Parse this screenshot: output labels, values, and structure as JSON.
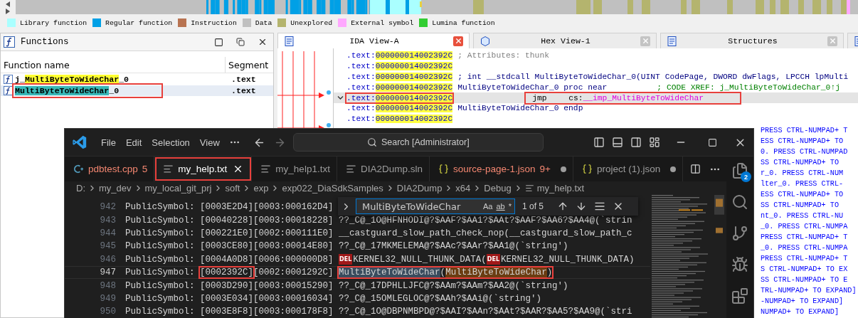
{
  "legend": [
    {
      "label": "Library function",
      "color": "#aaffff"
    },
    {
      "label": "Regular function",
      "color": "#00a0e6"
    },
    {
      "label": "Instruction",
      "color": "#b87351"
    },
    {
      "label": "Data",
      "color": "#c0c0c0"
    },
    {
      "label": "Unexplored",
      "color": "#b4b46e"
    },
    {
      "label": "External symbol",
      "color": "#ffa8ff"
    },
    {
      "label": "Lumina function",
      "color": "#32cd32"
    }
  ],
  "functions_panel": {
    "title": "Functions",
    "columns": [
      "Function name",
      "Segment"
    ],
    "rows": [
      {
        "prefix": "j_",
        "match": "MultiByteToWideChar",
        "suffix": "_0",
        "segment": ".text",
        "selected": false,
        "boxed": false
      },
      {
        "prefix": "",
        "match": "MultiByteToWideChar",
        "suffix": "_0",
        "segment": ".text",
        "selected": true,
        "boxed": true
      }
    ]
  },
  "ida_tabs": [
    {
      "label": "IDA View-A",
      "selected": true
    },
    {
      "label": "Hex View-1",
      "selected": false
    },
    {
      "label": "Structures",
      "selected": false
    },
    {
      "selected": false
    }
  ],
  "ida_listing": [
    {
      "segment": ".text:",
      "address": "000000014002392C",
      "kind": "attribute",
      "text": "; Attributes: thunk",
      "current": false,
      "boxed": false
    },
    {
      "segment": ".text:",
      "address": "000000014002392C",
      "kind": "blank",
      "current": false,
      "boxed": false
    },
    {
      "segment": ".text:",
      "address": "000000014002392C",
      "kind": "prototype",
      "text": "; int __stdcall MultiByteToWideChar_0(UINT CodePage, DWORD dwFlags, LPCCH lpMulti",
      "current": false,
      "boxed": false
    },
    {
      "segment": ".text:",
      "address": "000000014002392C",
      "kind": "label",
      "text": "MultiByteToWideChar_0 proc near",
      "xref": "; CODE XREF: j_MultiByteToWideChar_0↑j",
      "current": false,
      "boxed": false
    },
    {
      "segment": ".text:",
      "address": "000000014002392C",
      "kind": "instruction",
      "mnemonic": "jmp",
      "register": "cs:",
      "operand": "__imp_MultiByteToWideChar",
      "current": true,
      "boxed": true
    },
    {
      "segment": ".text:",
      "address": "000000014002392C",
      "kind": "label",
      "text": "MultiByteToWideChar_0 endp",
      "current": false,
      "boxed": false
    },
    {
      "segment": ".text:",
      "address": "000000014002392C",
      "kind": "blank",
      "current": false,
      "boxed": false
    }
  ],
  "ida_overflow": [
    "PRESS CTRL-NUMPAD+ T",
    "ESS CTRL-NUMPAD+ TO",
    "0. PRESS CTRL-NUMPAD",
    "SS CTRL-NUMPAD+ TO",
    "r_0. PRESS CTRL-NUM",
    "lter_0. PRESS CTRL-",
    "ESS CTRL-NUMPAD+ TO",
    "SS CTRL-NUMPAD+ TO",
    "nt_0. PRESS CTRL-NU",
    "_0. PRESS CTRL-NUMPA",
    "PRESS CTRL-NUMPAD+ T",
    "_0. PRESS CTRL-NUMPA",
    "PRESS CTRL-NUMPAD+ T",
    "S CTRL-NUMPAD+ TO EX",
    "SS CTRL-NUMPAD+ TO E",
    "TRL-NUMPAD+ TO EXPAND]",
    "-NUMPAD+ TO EXPAND]",
    "NUMPAD+ TO EXPAND]"
  ],
  "vscode": {
    "menu": [
      "File",
      "Edit",
      "Selection",
      "View"
    ],
    "search": "Search [Administrator]",
    "tabs": [
      {
        "label": "pdbtest.cpp",
        "badge": "5",
        "kind": "cpp",
        "problems": true,
        "modified": false,
        "selected": false,
        "boxed": false
      },
      {
        "label": "my_help.txt",
        "kind": "text",
        "problems": false,
        "modified": false,
        "selected": true,
        "boxed": true
      },
      {
        "label": "my_help1.txt",
        "kind": "text",
        "problems": false,
        "modified": false,
        "selected": false,
        "boxed": false
      },
      {
        "label": "DIA2Dump.sln",
        "kind": "text",
        "problems": false,
        "modified": false,
        "selected": false,
        "boxed": false
      },
      {
        "label": "source-page-1.json",
        "badge": "9+",
        "kind": "json",
        "problems": true,
        "modified": true,
        "selected": false,
        "boxed": false
      },
      {
        "label": "project (1).json",
        "kind": "json",
        "problems": false,
        "modified": true,
        "selected": false,
        "boxed": false
      }
    ],
    "breadcrumb": [
      "D:",
      "my_dev",
      "my_local_git_prj",
      "soft",
      "exp",
      "exp022_DiaSdkSamples",
      "DIA2Dump",
      "x64",
      "Debug",
      "my_help.txt"
    ],
    "find": {
      "value": "MultiByteToWideChar",
      "options": [
        "Aa",
        "ab",
        "*"
      ],
      "count": "1 of 5"
    },
    "explorer_badge": "2",
    "lines": [
      {
        "number": "942",
        "current": false,
        "segments": [
          {
            "kind": "text",
            "text": "PublicSymbol: [0003E2D4][0003:000162D4]",
            "boxed": false
          }
        ]
      },
      {
        "number": "943",
        "current": false,
        "segments": [
          {
            "kind": "text",
            "text": "PublicSymbol: [00040228][0003:00018228] ??_C@_1O@HFNHODI@?$AAF?$AA1?$AAt?$AAF?$AA6?$AA4@(`strin",
            "boxed": false
          }
        ]
      },
      {
        "number": "944",
        "current": false,
        "segments": [
          {
            "kind": "text",
            "text": "PublicSymbol: [000221E0][0002:000111E0] __castguard_slow_path_check_nop(__castguard_slow_path_c",
            "boxed": false
          }
        ]
      },
      {
        "number": "945",
        "current": false,
        "segments": [
          {
            "kind": "text",
            "text": "PublicSymbol: [0003CE80][0003:00014E80] ??_C@_17MKMELEMA@?$AAc?$AAr?$AA1@(`string')",
            "boxed": false
          }
        ]
      },
      {
        "number": "946",
        "current": false,
        "segments": [
          {
            "kind": "text",
            "text": "PublicSymbol: [0004A0D8][0006:000000D8] ",
            "boxed": false
          },
          {
            "kind": "ctrl",
            "text": "DEL",
            "boxed": false
          },
          {
            "kind": "text",
            "text": "KERNEL32_NULL_THUNK_DATA(",
            "boxed": false
          },
          {
            "kind": "ctrl",
            "text": "DEL",
            "boxed": false
          },
          {
            "kind": "text",
            "text": "KERNEL32_NULL_THUNK_DATA)",
            "boxed": false
          }
        ]
      },
      {
        "number": "947",
        "current": true,
        "segments": [
          {
            "kind": "text",
            "text": "PublicSymbol: ",
            "boxed": false
          },
          {
            "kind": "text",
            "text": "[0002392C]",
            "boxed": true
          },
          {
            "kind": "text",
            "text": "[0002:0001292C] ",
            "boxed": false
          },
          {
            "kind": "selection",
            "text": "MultiByteToWideChar",
            "boxed": true
          },
          {
            "kind": "text",
            "text": "(",
            "boxed": true
          },
          {
            "kind": "match",
            "text": "MultiByteToWideChar",
            "boxed": true
          },
          {
            "kind": "text",
            "text": ")",
            "boxed": true
          }
        ]
      },
      {
        "number": "948",
        "current": false,
        "segments": [
          {
            "kind": "text",
            "text": "PublicSymbol: [0003D290][0003:00015290] ??_C@_17DPHLLJFC@?$AAm?$AAm?$AA2@(`string')",
            "boxed": false
          }
        ]
      },
      {
        "number": "949",
        "current": false,
        "segments": [
          {
            "kind": "text",
            "text": "PublicSymbol: [0003E034][0003:00016034] ??_C@_15OMLEGLOC@?$AAh?$AAi@(`string')",
            "boxed": false
          }
        ]
      },
      {
        "number": "950",
        "current": false,
        "segments": [
          {
            "kind": "text",
            "text": "PublicSymbol: [0003E8F8][0003:000178F8] ??_C@_1O@DBPNMBPD@?$AAI?$AAn?$AAt?$AAR?$AA5?$AA9@(`stri",
            "boxed": false
          }
        ]
      }
    ]
  }
}
